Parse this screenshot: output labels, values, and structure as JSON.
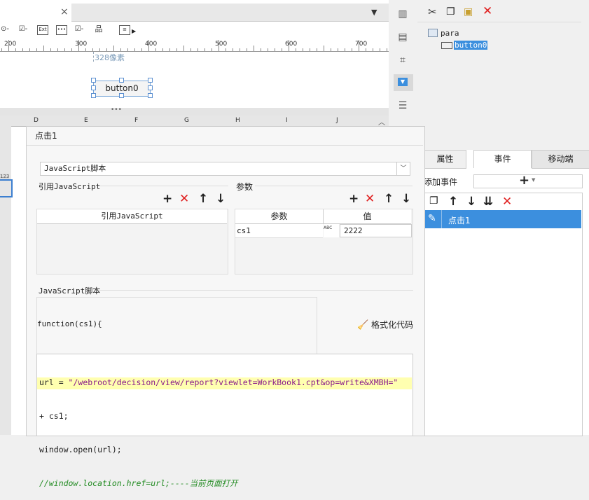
{
  "designer": {
    "tab_close": "×",
    "ruler_labels": [
      "200",
      "300",
      "400",
      "500",
      "600",
      "700"
    ],
    "width_hint": "328像素",
    "button_label": "button0",
    "toolbar_icons": [
      "radio-icon",
      "checkbox-icon",
      "text-icon",
      "password-icon",
      "checkbox-group-icon",
      "tree-icon",
      "more-icon"
    ]
  },
  "sheet": {
    "columns": [
      "D",
      "E",
      "F",
      "G",
      "H",
      "I",
      "J"
    ],
    "row_badge": "123"
  },
  "widget_tree": {
    "root": "para",
    "child": "button0"
  },
  "panel_tabs": [
    "属性",
    "事件",
    "移动端"
  ],
  "events": {
    "add_event_label": "添加事件",
    "add_symbol": "+",
    "items": [
      "点击1"
    ]
  },
  "dialog": {
    "title": "点击1",
    "type_select": "JavaScript脚本",
    "ref_js_label": "引用JavaScript",
    "ref_js_column": "引用JavaScript",
    "params_label": "参数",
    "params_columns": [
      "参数",
      "值"
    ],
    "params_rows": [
      {
        "name": "cs1",
        "type": "ABC",
        "value": "2222"
      }
    ],
    "script_label": "JavaScript脚本",
    "function_signature": "function(cs1){",
    "format_button": "格式化代码",
    "code": {
      "line1_var": "url = ",
      "line1_str": "\"/webroot/decision/view/report?viewlet=WorkBook1.cpt&op=write&XMBH=\"",
      "line2": "+ cs1;",
      "line3": "window.open(url);",
      "line4": "//window.location.href=url;----当前页面打开"
    }
  },
  "colors": {
    "accent": "#3c8fde",
    "delete_red": "#e02020",
    "highlight_line": "#ffffb0",
    "code_string": "#8a1a8a",
    "code_comment": "#228b22"
  }
}
